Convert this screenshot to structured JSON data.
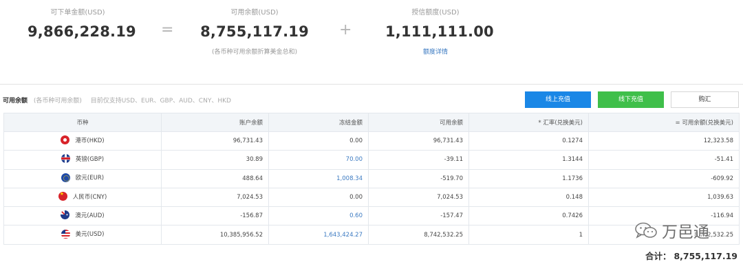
{
  "summary": {
    "orderable": {
      "label": "可下单金额(USD)",
      "value": "9,866,228.19"
    },
    "equals": "=",
    "available": {
      "label": "可用余额(USD)",
      "value": "8,755,117.19",
      "note": "(各币种可用余额折算美金总和)"
    },
    "plus": "+",
    "credit": {
      "label": "授信额度(USD)",
      "value": "1,111,111.00",
      "link": "额度详情"
    }
  },
  "toolbar": {
    "title": "可用余额",
    "note": "(各币种可用余额)",
    "support": "目前仅支持USD、EUR、GBP、AUD、CNY、HKD",
    "online_topup": "线上充值",
    "offline_topup": "线下充值",
    "exchange": "购汇"
  },
  "table": {
    "headers": [
      "币种",
      "账户余额",
      "冻结金额",
      "可用余额",
      "* 汇率(兑换美元)",
      "= 可用余额(兑换美元)"
    ],
    "rows": [
      {
        "currency": "港币(HKD)",
        "flag": "hong-kong-flag-icon",
        "balance": "96,731.43",
        "frozen": "0.00",
        "frozen_link": false,
        "available": "96,731.43",
        "rate": "0.1274",
        "usd": "12,323.58"
      },
      {
        "currency": "英镑(GBP)",
        "flag": "uk-flag-icon",
        "balance": "30.89",
        "frozen": "70.00",
        "frozen_link": true,
        "available": "-39.11",
        "rate": "1.3144",
        "usd": "-51.41"
      },
      {
        "currency": "欧元(EUR)",
        "flag": "eu-flag-icon",
        "balance": "488.64",
        "frozen": "1,008.34",
        "frozen_link": true,
        "available": "-519.70",
        "rate": "1.1736",
        "usd": "-609.92"
      },
      {
        "currency": "人民币(CNY)",
        "flag": "china-flag-icon",
        "balance": "7,024.53",
        "frozen": "0.00",
        "frozen_link": false,
        "available": "7,024.53",
        "rate": "0.148",
        "usd": "1,039.63"
      },
      {
        "currency": "澳元(AUD)",
        "flag": "australia-flag-icon",
        "balance": "-156.87",
        "frozen": "0.60",
        "frozen_link": true,
        "available": "-157.47",
        "rate": "0.7426",
        "usd": "-116.94"
      },
      {
        "currency": "美元(USD)",
        "flag": "us-flag-icon",
        "balance": "10,385,956.52",
        "frozen": "1,643,424.27",
        "frozen_link": true,
        "available": "8,742,532.25",
        "rate": "1",
        "usd": "8,742,532.25"
      }
    ]
  },
  "total": {
    "label": "合计：",
    "value": "8,755,117.19"
  },
  "watermark": {
    "text": "万邑通",
    "icon": "wechat-icon"
  },
  "colors": {
    "primary_blue": "#1a87e6",
    "green": "#3fbf4a",
    "link_blue": "#3a79c1",
    "header_bg": "#f2f5f8"
  }
}
